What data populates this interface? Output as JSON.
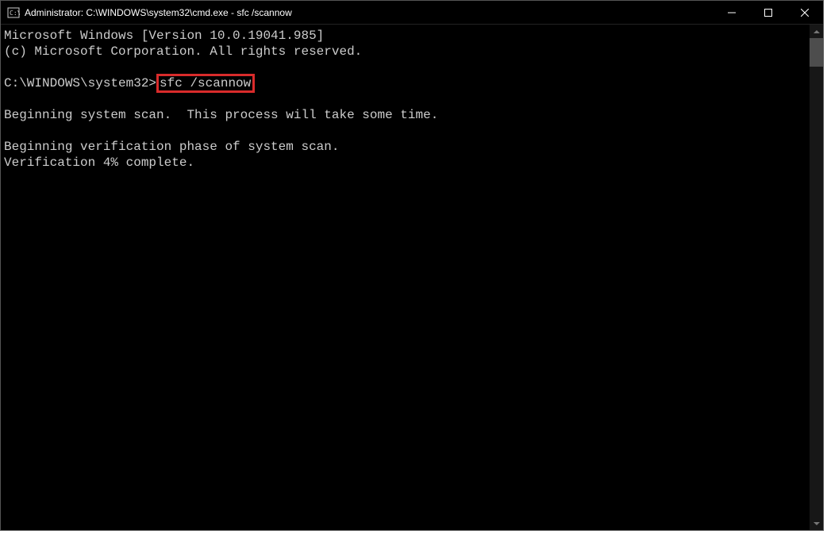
{
  "window": {
    "title": "Administrator: C:\\WINDOWS\\system32\\cmd.exe - sfc  /scannow"
  },
  "terminal": {
    "line1": "Microsoft Windows [Version 10.0.19041.985]",
    "line2": "(c) Microsoft Corporation. All rights reserved.",
    "prompt": "C:\\WINDOWS\\system32>",
    "command": "sfc /scannow",
    "line4": "Beginning system scan.  This process will take some time.",
    "line5": "Beginning verification phase of system scan.",
    "line6": "Verification 4% complete."
  }
}
